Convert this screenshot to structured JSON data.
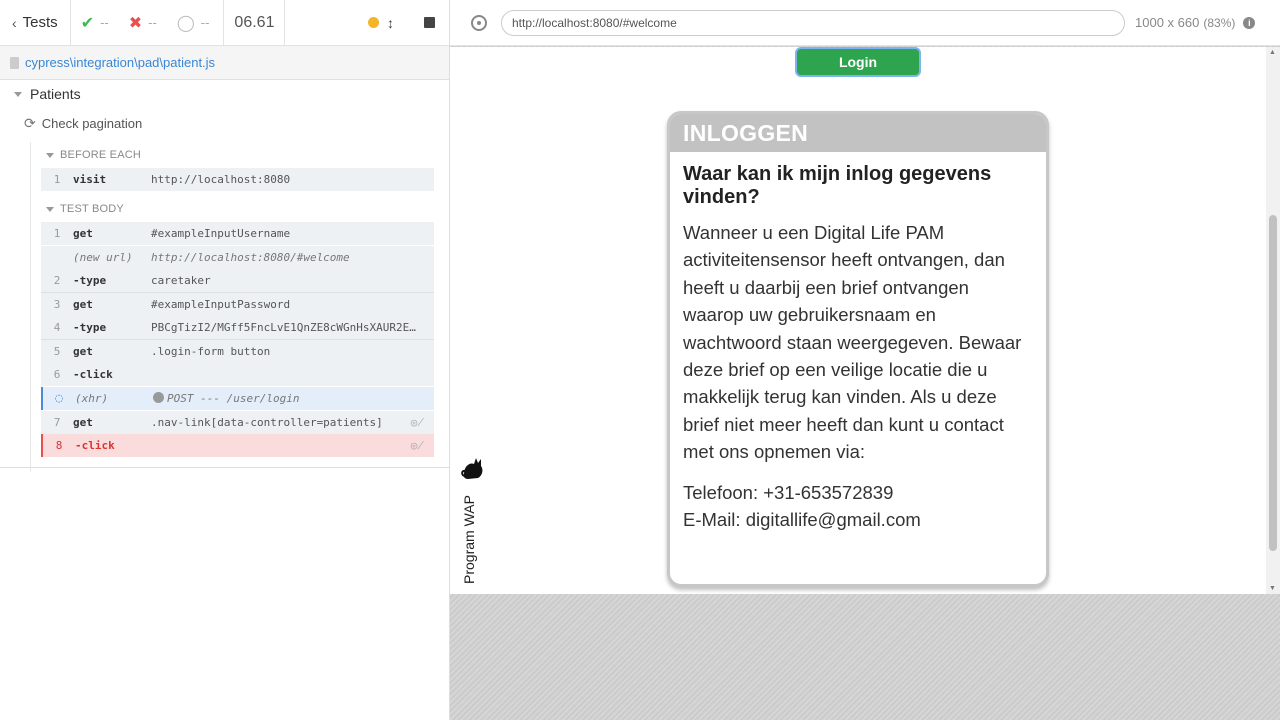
{
  "reporter": {
    "tests_label": "Tests",
    "stats": {
      "passed": "--",
      "failed": "--",
      "pending": "--"
    },
    "duration": "06.61",
    "spec_path": "cypress\\integration\\pad\\patient.js",
    "suite_title": "Patients",
    "test_title": "Check pagination",
    "before_each_label": "BEFORE EACH",
    "test_body_label": "TEST BODY",
    "before_each_commands": [
      {
        "num": "1",
        "name": "visit",
        "message": "http://localhost:8080"
      }
    ],
    "body_commands": [
      {
        "num": "1",
        "name": "get",
        "message": "#exampleInputUsername"
      },
      {
        "num": "",
        "name": "(new url)",
        "message": "http://localhost:8080/#welcome"
      },
      {
        "num": "2",
        "name": "-type",
        "message": "caretaker"
      },
      {
        "num": "3",
        "name": "get",
        "message": "#exampleInputPassword"
      },
      {
        "num": "4",
        "name": "-type",
        "message": "PBCgTizI2/MGff5FncLvE1QnZE8cWGnHsXAUR2EHf…"
      },
      {
        "num": "5",
        "name": "get",
        "message": ".login-form button"
      },
      {
        "num": "6",
        "name": "-click",
        "message": ""
      },
      {
        "num": "",
        "name": "(xhr)",
        "message": "POST --- /user/login"
      },
      {
        "num": "7",
        "name": "get",
        "message": ".nav-link[data-controller=patients]"
      },
      {
        "num": "8",
        "name": "-click",
        "message": ""
      }
    ]
  },
  "browser": {
    "url": "http://localhost:8080/#welcome",
    "viewport": "1000 x 660",
    "scale": "(83%)"
  },
  "app": {
    "login_button": "Login",
    "card_title": "INLOGGEN",
    "card_question": "Waar kan ik mijn inlog gegevens vinden?",
    "card_paragraph": "Wanneer u een Digital Life PAM activiteitensensor heeft ontvangen, dan heeft u daarbij een brief ontvangen waarop uw gebruikersnaam en wachtwoord staan weergegeven. Bewaar deze brief op een veilige locatie die u makkelijk terug kan vinden. Als u deze brief niet meer heeft dan kunt u contact met ons opnemen via:",
    "phone": "Telefoon: +31-653572839",
    "email": "E-Mail: digitallife@gmail.com",
    "brand": "Program WAP"
  },
  "colors": {
    "pass": "#3cba54",
    "fail": "#e94f4f",
    "running": "#f5b52b",
    "link": "#3a86d4",
    "login_green": "#2ea44f",
    "card_header": "#c2c2c2"
  },
  "icons": [
    "chevron-left-icon",
    "check-icon",
    "x-icon",
    "circle-icon",
    "status-dot-icon",
    "resize-icon",
    "stop-icon",
    "file-icon",
    "refresh-icon",
    "crosshair-icon",
    "info-icon",
    "eye-off-icon",
    "cat-icon"
  ]
}
